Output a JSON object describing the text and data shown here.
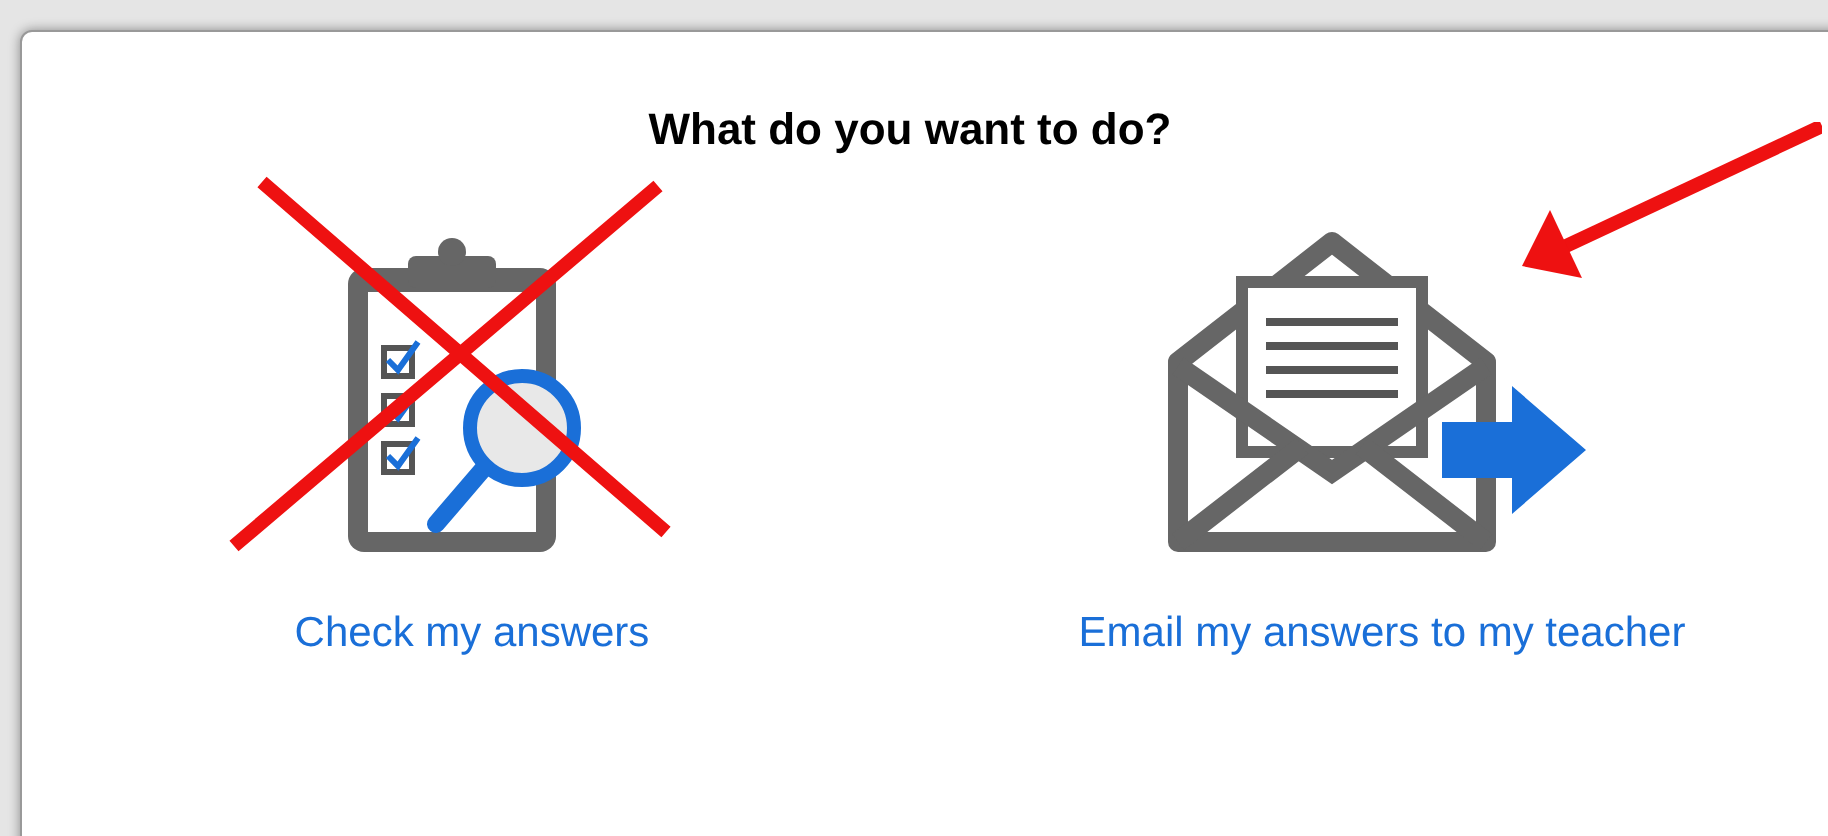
{
  "dialog": {
    "title": "What do you want to do?",
    "options": [
      {
        "kind": "check",
        "label": "Check my answers",
        "crossed_out": true,
        "pointed_at": false
      },
      {
        "kind": "email",
        "label": "Email my answers to my teacher",
        "crossed_out": false,
        "pointed_at": true
      }
    ]
  }
}
